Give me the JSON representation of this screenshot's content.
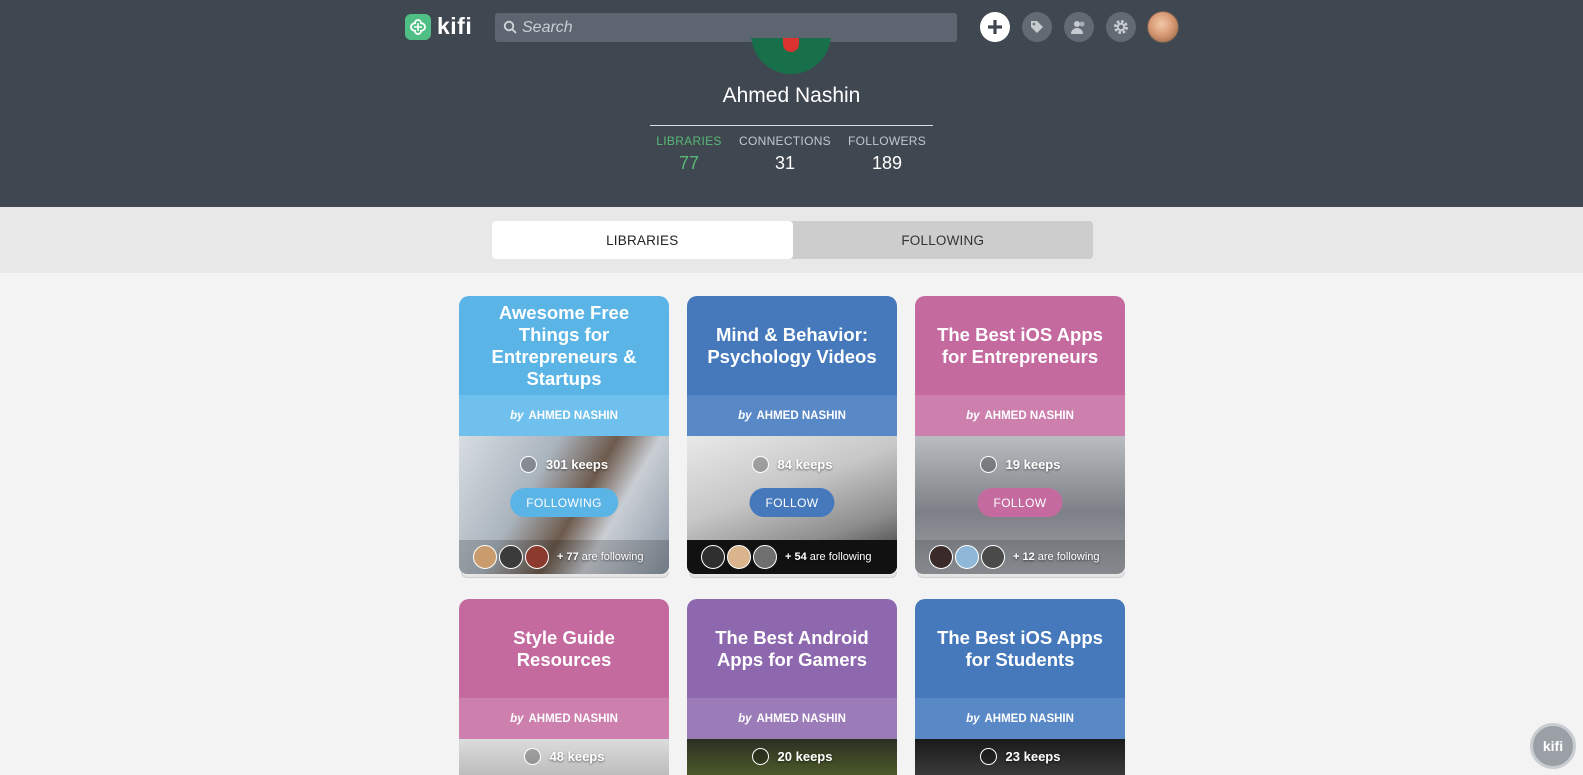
{
  "app": {
    "name": "kifi"
  },
  "search": {
    "placeholder": "Search"
  },
  "topbar": {
    "icons": [
      "add-icon",
      "tag-icon",
      "people-icon",
      "gear-icon",
      "user-avatar"
    ]
  },
  "profile": {
    "name": "Ahmed Nashin",
    "stats": [
      {
        "label": "LIBRARIES",
        "value": "77"
      },
      {
        "label": "CONNECTIONS",
        "value": "31"
      },
      {
        "label": "FOLLOWERS",
        "value": "189"
      }
    ]
  },
  "tabs": [
    {
      "label": "LIBRARIES",
      "active": true
    },
    {
      "label": "FOLLOWING",
      "active": false
    }
  ],
  "libraries": [
    {
      "title": "Awesome Free Things for Entrepreneurs & Startups",
      "by": "by",
      "owner": "AHMED NASHIN",
      "keeps": "301 keeps",
      "button": "FOLLOWING",
      "following_count": "+ 77",
      "following_text": "are following",
      "color": "#5ab4e6"
    },
    {
      "title": "Mind & Behavior: Psychology Videos",
      "by": "by",
      "owner": "AHMED NASHIN",
      "keeps": "84 keeps",
      "button": "FOLLOW",
      "following_count": "+ 54",
      "following_text": "are following",
      "color": "#4579bc"
    },
    {
      "title": "The Best iOS Apps for Entrepreneurs",
      "by": "by",
      "owner": "AHMED NASHIN",
      "keeps": "19 keeps",
      "button": "FOLLOW",
      "following_count": "+ 12",
      "following_text": "are following",
      "color": "#c46a9f"
    },
    {
      "title": "Style Guide Resources",
      "by": "by",
      "owner": "AHMED NASHIN",
      "keeps": "48 keeps",
      "color": "#c46a9f"
    },
    {
      "title": "The Best Android Apps for Gamers",
      "by": "by",
      "owner": "AHMED NASHIN",
      "keeps": "20 keeps",
      "color": "#8e68ae"
    },
    {
      "title": "The Best iOS Apps for Students",
      "by": "by",
      "owner": "AHMED NASHIN",
      "keeps": "23 keeps",
      "color": "#4579bc"
    }
  ],
  "widget": {
    "label": "kifi"
  }
}
